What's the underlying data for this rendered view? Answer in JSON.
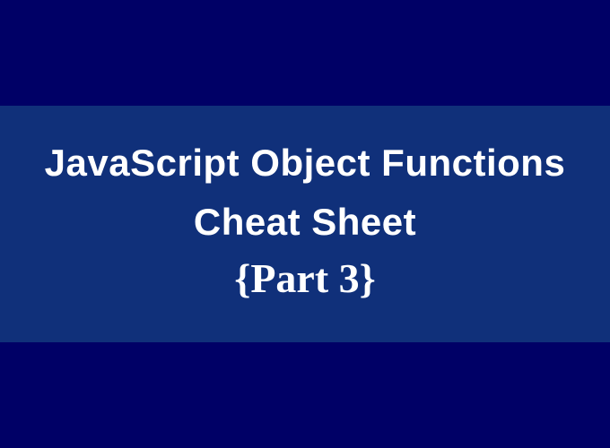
{
  "banner": {
    "title_line1": "JavaScript Object Functions",
    "title_line2": "Cheat Sheet",
    "subtitle_open": "{",
    "subtitle_text": "Part 3",
    "subtitle_close": "}"
  }
}
